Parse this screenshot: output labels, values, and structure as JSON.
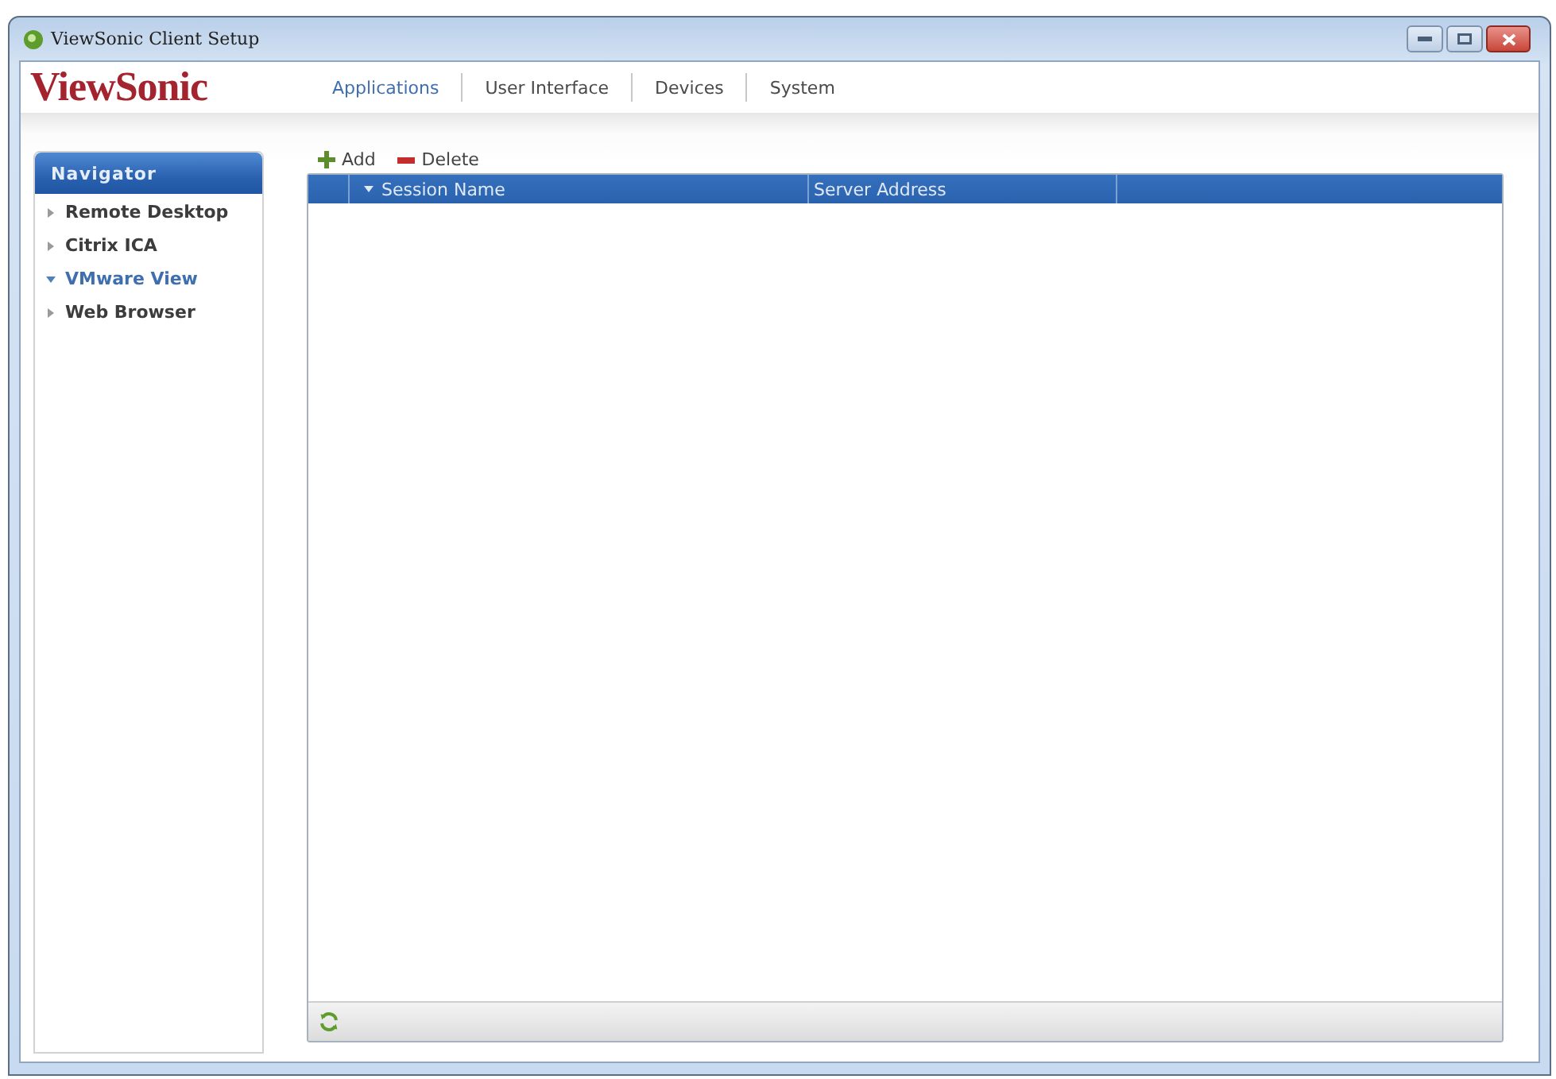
{
  "window": {
    "title": "ViewSonic Client Setup"
  },
  "logo": "ViewSonic",
  "tabs": [
    {
      "label": "Applications",
      "selected": true
    },
    {
      "label": "User Interface",
      "selected": false
    },
    {
      "label": "Devices",
      "selected": false
    },
    {
      "label": "System",
      "selected": false
    }
  ],
  "navigator": {
    "title": "Navigator",
    "items": [
      {
        "label": "Remote Desktop",
        "selected": false
      },
      {
        "label": "Citrix ICA",
        "selected": false
      },
      {
        "label": "VMware View",
        "selected": true
      },
      {
        "label": "Web Browser",
        "selected": false
      }
    ]
  },
  "toolbar": {
    "buttons": [
      {
        "kind": "add",
        "label": "Add"
      },
      {
        "kind": "delete",
        "label": "Delete"
      }
    ]
  },
  "table": {
    "columns": [
      {
        "label": "Session Name",
        "sorted": true
      },
      {
        "label": "Server Address",
        "sorted": false
      }
    ]
  }
}
